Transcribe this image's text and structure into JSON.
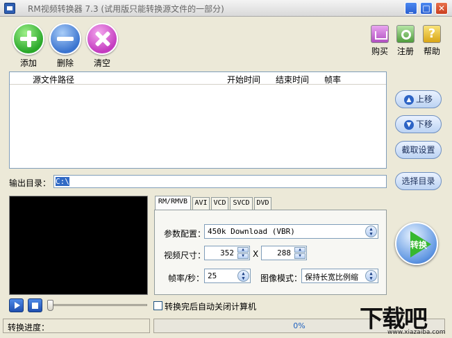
{
  "window": {
    "title": "RM视频转换器 7.3 (试用版只能转换源文件的一部分)",
    "min_label": "_",
    "max_label": "□",
    "close_label": "✕"
  },
  "toolbar": {
    "add_label": "添加",
    "delete_label": "删除",
    "clear_label": "清空",
    "buy_label": "购买",
    "register_label": "注册",
    "help_label": "帮助",
    "help_glyph": "?"
  },
  "file_list": {
    "columns": [
      "源文件路径",
      "开始时间",
      "结束时间",
      "帧率"
    ],
    "rows": []
  },
  "side_buttons": {
    "up_label": "上移",
    "up_glyph": "▲",
    "down_label": "下移",
    "down_glyph": "▼",
    "capture_label": "截取设置",
    "choose_dir_label": "选择目录"
  },
  "output": {
    "label": "输出目录：",
    "path": "C:\\"
  },
  "tabs": [
    "RM/RMVB",
    "AVI",
    "VCD",
    "SVCD",
    "DVD"
  ],
  "settings": {
    "profile_label": "参数配置：",
    "profile_value": "450k Download (VBR)",
    "size_label": "视频尺寸：",
    "width": "352",
    "x_label": "X",
    "height": "288",
    "fps_label": "帧率/秒：",
    "fps_value": "25",
    "image_mode_label": "图像模式：",
    "image_mode_value": "保持长宽比例缩"
  },
  "convert": {
    "label": "转换"
  },
  "playback": {
    "position": 0
  },
  "auto_shutdown": {
    "label": "转换完后自动关闭计算机",
    "checked": false
  },
  "status": {
    "progress_label": "转换进度：",
    "progress_text": "0%",
    "progress_value": 0
  },
  "watermark": {
    "logo_text": "下载吧",
    "url": "www.xiazaiba.com"
  },
  "colors": {
    "accent": "#316ac5",
    "progress": "#3d95ff"
  }
}
